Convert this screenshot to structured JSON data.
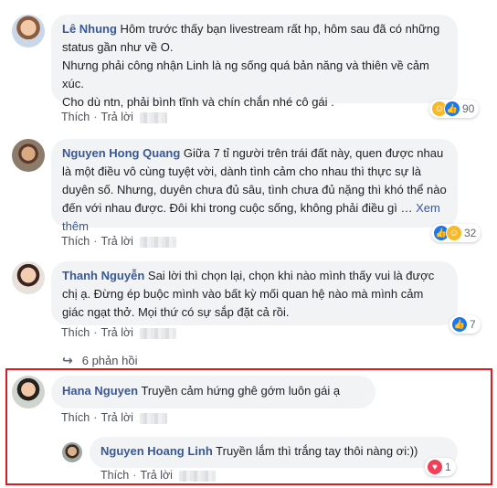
{
  "comments": [
    {
      "author": "Lê Nhung",
      "text": " Hôm trước thấy bạn livestream rất hp, hôm sau đã có những status gần như về O.",
      "line2": "Nhưng phải công nhận Linh là ng sống quá bản năng và thiên về cảm xúc.",
      "line3": "Cho dù ntn, phải bình tĩnh và chín chắn nhé cô gái .",
      "like": "Thích",
      "reply": "Trả lời",
      "reaction_count": "90"
    },
    {
      "author": "Nguyen Hong Quang",
      "text": " Giữa 7 tỉ người trên trái đất này, quen được nhau là một điều vô cùng tuyệt vời, dành tình cảm cho nhau thì thực sự là duyên số. Nhưng, duyên chưa đủ sâu, tình chưa đủ nặng thì khó thể nào đến với nhau được. Đôi khi trong cuộc sống, không phải điều gì … ",
      "see_more": "Xem thêm",
      "like": "Thích",
      "reply": "Trả lời",
      "reaction_count": "32"
    },
    {
      "author": "Thanh Nguyễn",
      "text": " Sai lời thì chọn lại, chọn khi nào mình thấy vui là được chị ạ. Đừng ép buộc mình vào bất kỳ mối quan hệ nào mà mình cảm giác ngạt thở. Mọi thứ có sự sắp đặt cả rồi.",
      "like": "Thích",
      "reply": "Trả lời",
      "reaction_count": "7",
      "replies_label": "6 phản hồi"
    },
    {
      "author": "Hana Nguyen",
      "text": " Truyền cảm hứng ghê gớm luôn gái ạ",
      "like": "Thích",
      "reply": "Trả lời"
    },
    {
      "author": "Nguyen Hoang Linh",
      "text": " Truyền lắm thì trắng tay thôi nàng ơi:))",
      "like": "Thích",
      "reply": "Trả lời",
      "reaction_count": "1"
    }
  ],
  "colors": {
    "author": "#385898",
    "highlight": "#d81c22",
    "bubble": "#f2f3f5"
  }
}
